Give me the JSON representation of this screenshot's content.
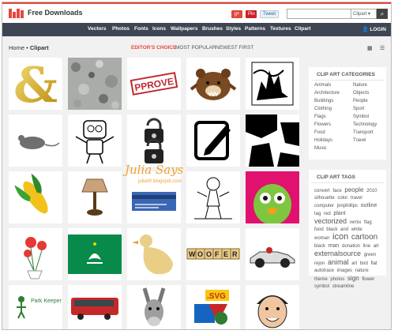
{
  "header": {
    "logo_text": "Free Downloads",
    "social": {
      "google": "g+",
      "pinterest": "Pin it",
      "twitter": "Tweet"
    },
    "search": {
      "value": "",
      "placeholder": "",
      "category": "Clipart"
    }
  },
  "nav": {
    "items": [
      "Vectors",
      "Photos",
      "Fonts",
      "Icons",
      "Wallpapers",
      "Brushes",
      "Styles",
      "Patterns",
      "Textures",
      "Clipart"
    ],
    "login": "LOGIN"
  },
  "toolbar": {
    "breadcrumb_home": "Home",
    "breadcrumb_sep": " • ",
    "breadcrumb_current": "Clipart",
    "sort_options": [
      "EDITOR'S CHOICE",
      "MOST POPULAR",
      "NEWEST FIRST"
    ],
    "active_sort": "EDITOR'S CHOICE"
  },
  "thumbnails": [
    {
      "name": "ampersand"
    },
    {
      "name": "granite-texture"
    },
    {
      "name": "approve-stamp"
    },
    {
      "name": "bear"
    },
    {
      "name": "ink-tree"
    },
    {
      "name": "mouse"
    },
    {
      "name": "robot"
    },
    {
      "name": "padlocks"
    },
    {
      "name": "edit-icon"
    },
    {
      "name": "bw-abstract"
    },
    {
      "name": "corn"
    },
    {
      "name": "lamp"
    },
    {
      "name": "card"
    },
    {
      "name": "sketch-figure"
    },
    {
      "name": "alien"
    },
    {
      "name": "balloon-flowers"
    },
    {
      "name": "macau-flag"
    },
    {
      "name": "duck"
    },
    {
      "name": "woofer-tiles"
    },
    {
      "name": "race-car"
    },
    {
      "name": "park-keeper"
    },
    {
      "name": "bus"
    },
    {
      "name": "donkey"
    },
    {
      "name": "svg-shapes"
    },
    {
      "name": "face"
    }
  ],
  "thumbnail_text": {
    "approve": "PPROVE",
    "woofer": [
      "W",
      "O",
      "O",
      "F",
      "E",
      "R"
    ],
    "park_keeper": "Park Keeper",
    "svg": ".SVG"
  },
  "sidebar": {
    "categories_title": "CLIP ART CATEGORIES",
    "categories_left": [
      "Animals",
      "Architecture",
      "Buildings",
      "Clothing",
      "Flags",
      "Flowers",
      "Food",
      "Holidays",
      "Music"
    ],
    "categories_right": [
      "Nature",
      "Objects",
      "People",
      "Sport",
      "Symbol",
      "Technology",
      "Transport",
      "Travel"
    ],
    "tags_title": "CLIP ART TAGS",
    "tags": [
      {
        "t": "convert",
        "s": 6
      },
      {
        "t": "face",
        "s": 6
      },
      {
        "t": "people",
        "s": 8
      },
      {
        "t": "2010",
        "s": 6
      },
      {
        "t": "silhouette",
        "s": 6
      },
      {
        "t": "color",
        "s": 6
      },
      {
        "t": "travel",
        "s": 6
      },
      {
        "t": "computer",
        "s": 6
      },
      {
        "t": "jonphillips",
        "s": 6
      },
      {
        "t": "outline",
        "s": 7
      },
      {
        "t": "tag",
        "s": 6
      },
      {
        "t": "red",
        "s": 6
      },
      {
        "t": "plant",
        "s": 7
      },
      {
        "t": "vectorized",
        "s": 9
      },
      {
        "t": "remix",
        "s": 6
      },
      {
        "t": "flag",
        "s": 6
      },
      {
        "t": "food",
        "s": 6
      },
      {
        "t": "black",
        "s": 6
      },
      {
        "t": "and",
        "s": 6
      },
      {
        "t": "white",
        "s": 6
      },
      {
        "t": "woman",
        "s": 6
      },
      {
        "t": "icon",
        "s": 11
      },
      {
        "t": "cartoon",
        "s": 10
      },
      {
        "t": "black",
        "s": 6
      },
      {
        "t": "man",
        "s": 7
      },
      {
        "t": "donation",
        "s": 6
      },
      {
        "t": "line",
        "s": 6
      },
      {
        "t": "art",
        "s": 6
      },
      {
        "t": "externalsource",
        "s": 9
      },
      {
        "t": "green",
        "s": 6
      },
      {
        "t": "rejon",
        "s": 6
      },
      {
        "t": "animal",
        "s": 9
      },
      {
        "t": "art",
        "s": 6
      },
      {
        "t": "bird",
        "s": 6
      },
      {
        "t": "flat",
        "s": 6
      },
      {
        "t": "autotrace",
        "s": 6
      },
      {
        "t": "images",
        "s": 6
      },
      {
        "t": "nature",
        "s": 6
      },
      {
        "t": "theme",
        "s": 6
      },
      {
        "t": "photos",
        "s": 6
      },
      {
        "t": "sign",
        "s": 8
      },
      {
        "t": "flower",
        "s": 6
      },
      {
        "t": "symbol",
        "s": 6
      },
      {
        "t": "streamline",
        "s": 6
      }
    ]
  },
  "watermark": {
    "title": "Julia Says",
    "subtitle": "julia00.blogspot.com"
  },
  "colors": {
    "accent": "#e8473f",
    "nav_bg": "#3e4654",
    "page_bg": "#f1f1f1"
  }
}
